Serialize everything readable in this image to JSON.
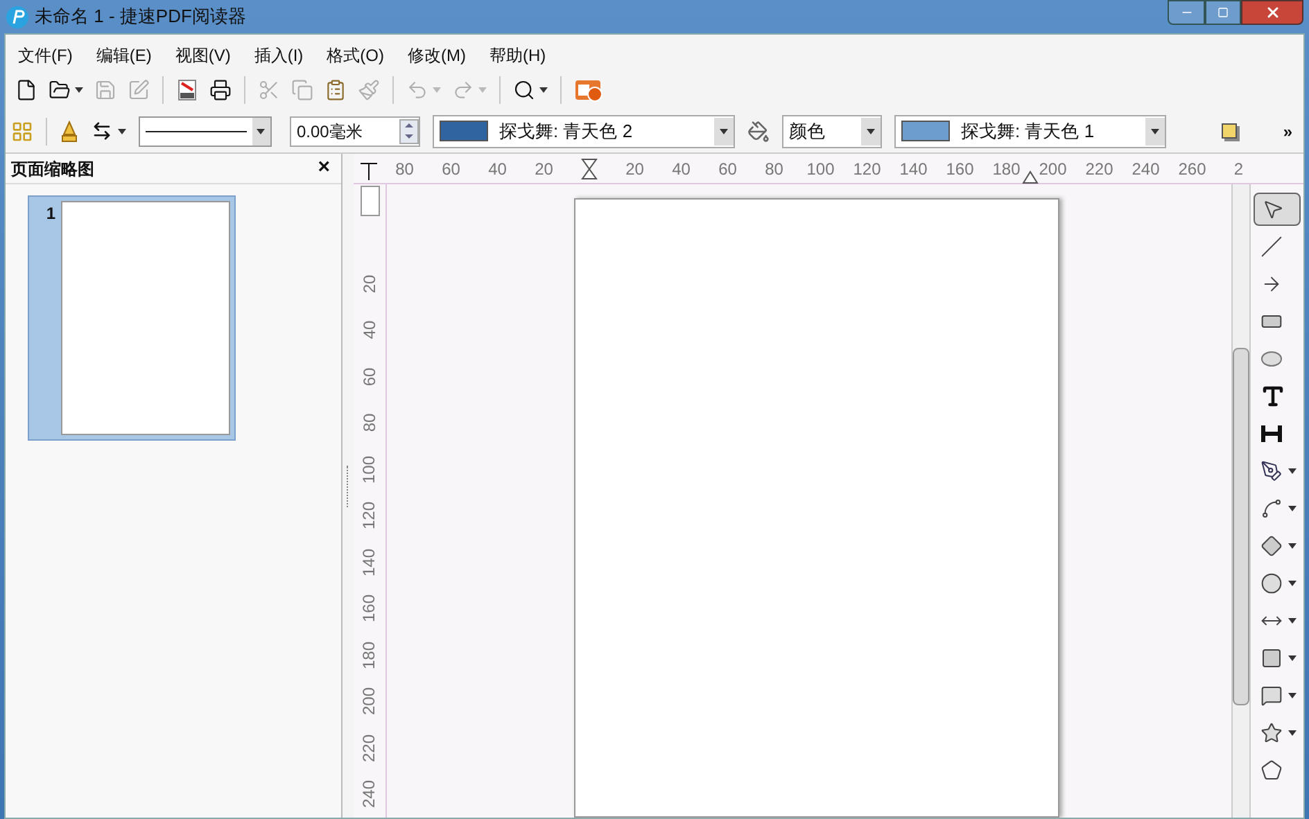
{
  "window": {
    "title": "未命名 1 - 捷速PDF阅读器"
  },
  "menu": [
    "文件(F)",
    "编辑(E)",
    "视图(V)",
    "插入(I)",
    "格式(O)",
    "修改(M)",
    "帮助(H)"
  ],
  "toolbar": {
    "items": [
      {
        "kind": "new",
        "disabled": false,
        "dropdown": false
      },
      {
        "kind": "open",
        "disabled": false,
        "dropdown": true
      },
      {
        "kind": "save",
        "disabled": true,
        "dropdown": false
      },
      {
        "kind": "edit",
        "disabled": true,
        "dropdown": false
      },
      {
        "kind": "pdf",
        "disabled": false,
        "dropdown": false
      },
      {
        "kind": "print",
        "disabled": false,
        "dropdown": false
      },
      {
        "kind": "cut",
        "disabled": true,
        "dropdown": false
      },
      {
        "kind": "copy",
        "disabled": true,
        "dropdown": false
      },
      {
        "kind": "paste",
        "disabled": false,
        "dropdown": false
      },
      {
        "kind": "brush",
        "disabled": true,
        "dropdown": false
      },
      {
        "kind": "undo",
        "disabled": true,
        "dropdown": true
      },
      {
        "kind": "redo",
        "disabled": true,
        "dropdown": true
      },
      {
        "kind": "zoom",
        "disabled": false,
        "dropdown": true
      },
      {
        "kind": "buy",
        "disabled": false,
        "dropdown": false
      }
    ]
  },
  "format_bar": {
    "line_width": "0.00毫米",
    "line_color": {
      "label": "探戈舞: 青天色 2",
      "color": "#2f64a0"
    },
    "fill_mode": "颜色",
    "fill_color": {
      "label": "探戈舞: 青天色 1",
      "color": "#6d9ccf"
    },
    "overflow": "»"
  },
  "thumbnail_panel": {
    "title": "页面缩略图",
    "close": "×",
    "pages": [
      {
        "number": "1",
        "selected": true
      }
    ]
  },
  "ruler": {
    "horizontal": [
      {
        "kind": "label",
        "text": "80"
      },
      {
        "kind": "label",
        "text": "60"
      },
      {
        "kind": "label",
        "text": "40"
      },
      {
        "kind": "label",
        "text": "20"
      },
      {
        "kind": "origin"
      },
      {
        "kind": "label",
        "text": "20"
      },
      {
        "kind": "label",
        "text": "40"
      },
      {
        "kind": "label",
        "text": "60"
      },
      {
        "kind": "label",
        "text": "80"
      },
      {
        "kind": "label",
        "text": "100"
      },
      {
        "kind": "label",
        "text": "120"
      },
      {
        "kind": "label",
        "text": "140"
      },
      {
        "kind": "label",
        "text": "160"
      },
      {
        "kind": "label",
        "text": "180"
      },
      {
        "kind": "margin"
      },
      {
        "kind": "label",
        "text": "200"
      },
      {
        "kind": "label",
        "text": "220"
      },
      {
        "kind": "label",
        "text": "240"
      },
      {
        "kind": "label",
        "text": "260"
      },
      {
        "kind": "label",
        "text": "2"
      }
    ],
    "vertical": [
      "20",
      "40",
      "60",
      "80",
      "100",
      "120",
      "140",
      "160",
      "180",
      "200",
      "220",
      "240"
    ]
  },
  "tools": [
    {
      "kind": "select",
      "selected": true,
      "dropdown": false
    },
    {
      "kind": "line",
      "selected": false,
      "dropdown": false
    },
    {
      "kind": "arrow",
      "selected": false,
      "dropdown": false
    },
    {
      "kind": "rect",
      "selected": false,
      "dropdown": false
    },
    {
      "kind": "ellipse",
      "selected": false,
      "dropdown": false
    },
    {
      "kind": "text",
      "selected": false,
      "dropdown": false
    },
    {
      "kind": "vtext",
      "selected": false,
      "dropdown": false
    },
    {
      "kind": "curve",
      "selected": false,
      "dropdown": true
    },
    {
      "kind": "connector",
      "selected": false,
      "dropdown": true
    },
    {
      "kind": "diamond",
      "selected": false,
      "dropdown": true
    },
    {
      "kind": "circle",
      "selected": false,
      "dropdown": true
    },
    {
      "kind": "double-arrow",
      "selected": false,
      "dropdown": true
    },
    {
      "kind": "square",
      "selected": false,
      "dropdown": true
    },
    {
      "kind": "callout",
      "selected": false,
      "dropdown": true
    },
    {
      "kind": "star",
      "selected": false,
      "dropdown": true
    },
    {
      "kind": "polygon",
      "selected": false,
      "dropdown": false
    }
  ]
}
